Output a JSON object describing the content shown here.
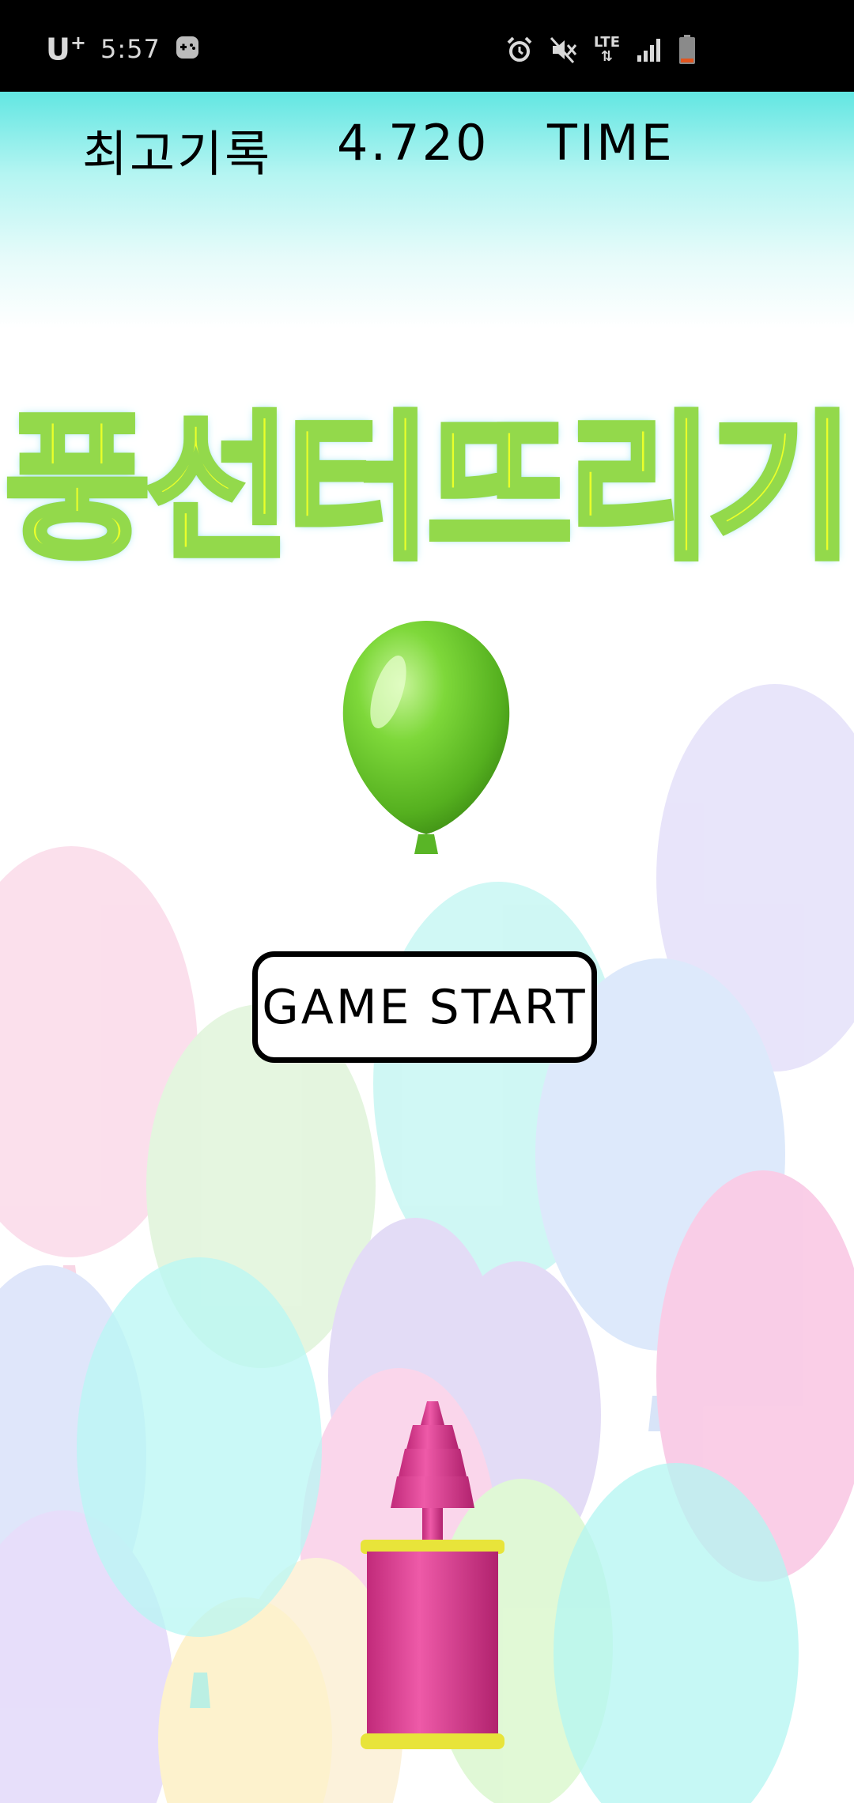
{
  "status_bar": {
    "carrier": "U",
    "carrier_plus": "+",
    "time": "5:57",
    "network": "LTE",
    "icons": [
      "game-launcher-icon",
      "alarm-icon",
      "mute-icon",
      "lte-icon",
      "signal-icon",
      "battery-icon"
    ]
  },
  "hud": {
    "best_label": "최고기록",
    "best_value": "4.720",
    "time_label": "TIME"
  },
  "title": "풍선터뜨리기",
  "start_button": "GAME START",
  "colors": {
    "hud_gradient_top": "#62e6e2",
    "title_fill": "#eaff2a",
    "title_outline": "#93d94b",
    "hero_balloon": "#6cc72a",
    "pump_body": "#e43f93",
    "pump_rim": "#e8e43a"
  }
}
